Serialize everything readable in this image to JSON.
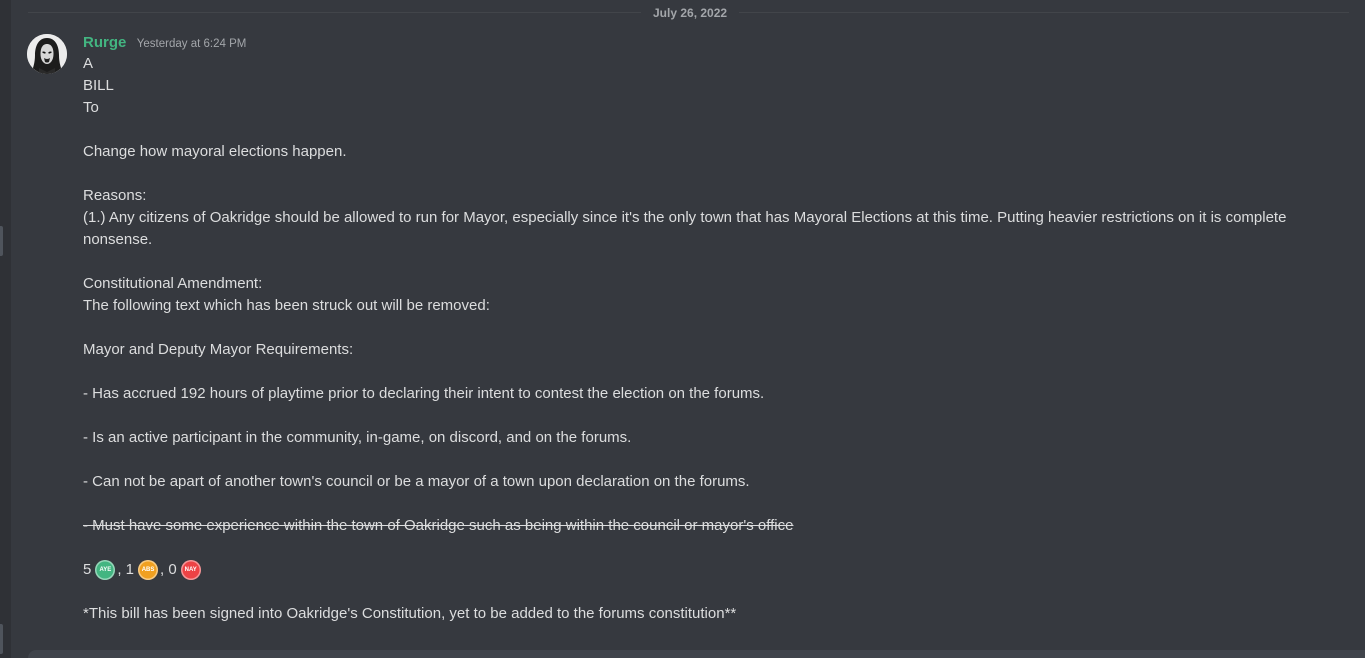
{
  "date_divider": "July 26, 2022",
  "message": {
    "author": "Rurge",
    "timestamp": "Yesterday at 6:24 PM",
    "author_color": "#43b581",
    "lines": [
      "A",
      "BILL",
      "To",
      "",
      "Change how mayoral elections happen.",
      "",
      "Reasons:",
      "(1.) Any citizens of Oakridge should be allowed to run for Mayor, especially since it's the only town that has Mayoral Elections at this time. Putting heavier restrictions on it is complete nonsense.",
      "",
      "Constitutional Amendment:",
      "The following text which has been struck out will be removed:",
      "",
      "Mayor and Deputy Mayor Requirements:",
      "",
      "- Has accrued 192 hours of playtime prior to declaring their intent to contest the election on the forums.",
      "",
      "- Is an active participant in the community, in-game, on discord, and on the forums.",
      "",
      "- Can not be apart of another town's council or be a mayor of a town upon declaration on the forums.",
      ""
    ],
    "struck_line": "- Must have some experience within the town of Oakridge such as being within the council or mayor's office",
    "votes": {
      "aye_count": "5",
      "aye_label": "AYE",
      "aye_color": "#43b581",
      "sep1": ", 1",
      "abs_label": "ABS",
      "abs_color": "#f0a020",
      "sep2": ", 0",
      "nay_label": "NAY",
      "nay_color": "#ed4245"
    },
    "footer_note": "*This bill has been signed into Oakridge's Constitution, yet to be added to the forums constitution**"
  }
}
